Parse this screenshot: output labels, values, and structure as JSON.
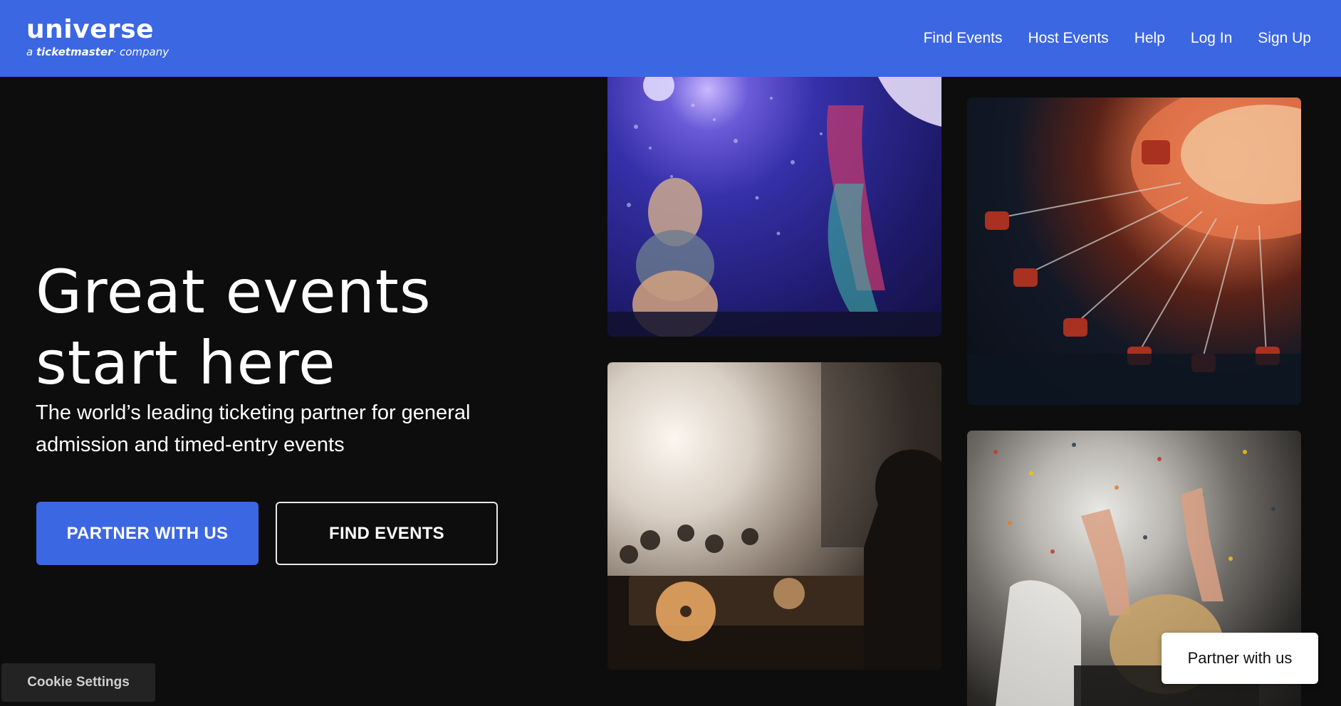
{
  "brand": {
    "name": "universe",
    "tagline_prefix": "a",
    "tagline_brand": "ticketmaster",
    "tagline_suffix": "company",
    "color": "#3c67e3"
  },
  "nav": {
    "items": [
      "Find Events",
      "Host Events",
      "Help",
      "Log In",
      "Sign Up"
    ]
  },
  "hero": {
    "title_line1": "Great events",
    "title_line2": "start here",
    "subtitle": "The world’s leading ticketing partner for general admission and timed-entry events",
    "primary_cta": "PARTNER WITH US",
    "secondary_cta": "FIND EVENTS"
  },
  "gallery": {
    "photos": [
      {
        "name": "photo-mermaid-show"
      },
      {
        "name": "photo-swing-ride"
      },
      {
        "name": "photo-dj-set"
      },
      {
        "name": "photo-confetti-crowd"
      }
    ]
  },
  "cookie": {
    "label": "Cookie Settings"
  },
  "floating_cta": {
    "label": "Partner with us"
  }
}
